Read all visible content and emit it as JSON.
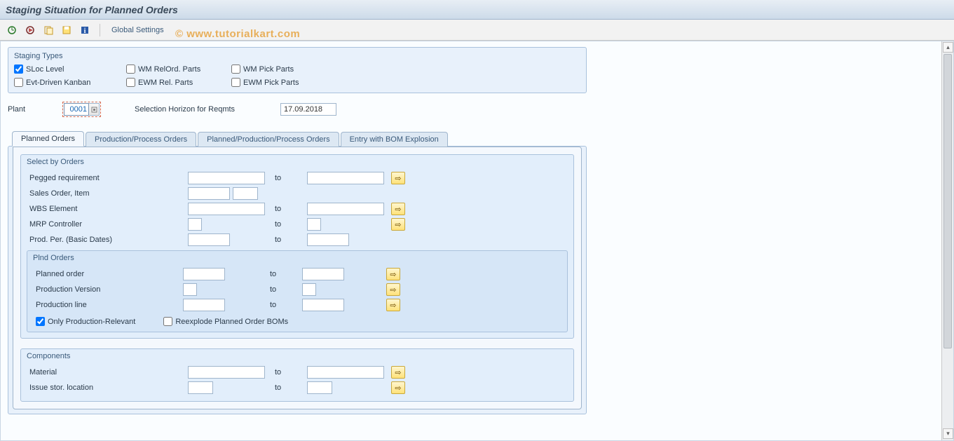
{
  "title": "Staging Situation for Planned Orders",
  "watermark": "© www.tutorialkart.com",
  "toolbar": {
    "global_settings": "Global Settings"
  },
  "staging_types": {
    "title": "Staging Types",
    "sloc_level": {
      "label": "SLoc Level",
      "checked": true
    },
    "wm_relord_parts": {
      "label": "WM RelOrd. Parts",
      "checked": false
    },
    "wm_pick_parts": {
      "label": "WM Pick Parts",
      "checked": false
    },
    "evt_driven_kanban": {
      "label": "Evt-Driven Kanban",
      "checked": false
    },
    "ewm_rel_parts": {
      "label": "EWM Rel. Parts",
      "checked": false
    },
    "ewm_pick_parts": {
      "label": "EWM Pick Parts",
      "checked": false
    }
  },
  "plant": {
    "label": "Plant",
    "value": "0001"
  },
  "selection_horizon": {
    "label": "Selection Horizon for Reqmts",
    "value": "17.09.2018"
  },
  "tabs": [
    "Planned Orders",
    "Production/Process Orders",
    "Planned/Production/Process Orders",
    "Entry with BOM Explosion"
  ],
  "to_label": "to",
  "select_by_orders": {
    "title": "Select by Orders",
    "pegged_requirement": "Pegged requirement",
    "sales_order_item": "Sales Order, Item",
    "wbs_element": "WBS Element",
    "mrp_controller": "MRP Controller",
    "prod_per_basic": "Prod. Per. (Basic Dates)",
    "plnd_orders": {
      "title": "Plnd Orders",
      "planned_order": "Planned order",
      "production_version": "Production Version",
      "production_line": "Production line",
      "only_prod_relevant": {
        "label": "Only Production-Relevant",
        "checked": true
      },
      "reexplode_boms": {
        "label": "Reexplode Planned Order BOMs",
        "checked": false
      }
    }
  },
  "components": {
    "title": "Components",
    "material": "Material",
    "issue_stor_location": "Issue stor. location"
  }
}
